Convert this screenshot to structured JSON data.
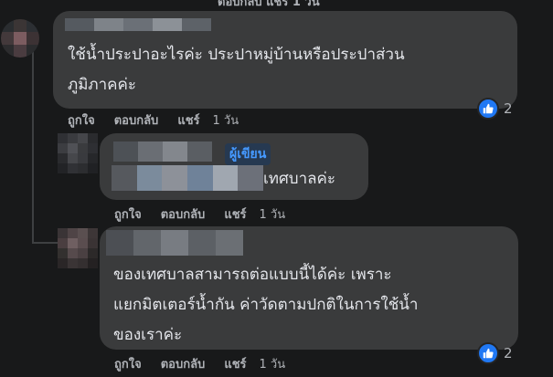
{
  "top_cutoff": "ตอบกลับ   แชร์   1 วัน",
  "comments": [
    {
      "text": "ใช้น้ำประปาอะไรค่ะ ประปาหมู่บ้านหรือประปาส่วน\nภูมิภาคค่ะ",
      "actions": {
        "like": "ถูกใจ",
        "reply": "ตอบกลับ",
        "share": "แชร์",
        "time": "1 วัน"
      },
      "reaction_count": "2"
    },
    {
      "author_badge": "ผู้เขียน",
      "text": "เทศบาลค่ะ",
      "actions": {
        "like": "ถูกใจ",
        "reply": "ตอบกลับ",
        "share": "แชร์",
        "time": "1 วัน"
      }
    },
    {
      "text": "ของเทศบาลสามารถต่อแบบนี้ได้ค่ะ เพราะ\nแยกมิตเตอร์น้ำกัน ค่าวัดตามปกติในการใช้น้ำ\nของเราค่ะ",
      "actions": {
        "like": "ถูกใจ",
        "reply": "ตอบกลับ",
        "share": "แชร์",
        "time": "1 วัน"
      },
      "reaction_count": "2"
    }
  ],
  "colors": {
    "background": "#18191a",
    "bubble": "#3a3b3c",
    "text": "#e4e6eb",
    "secondary_text": "#b0b3b8",
    "like_blue": "#2078f4",
    "author_badge_text": "#4599ff",
    "author_badge_bg": "#263951"
  },
  "icons": [
    "like-icon"
  ]
}
